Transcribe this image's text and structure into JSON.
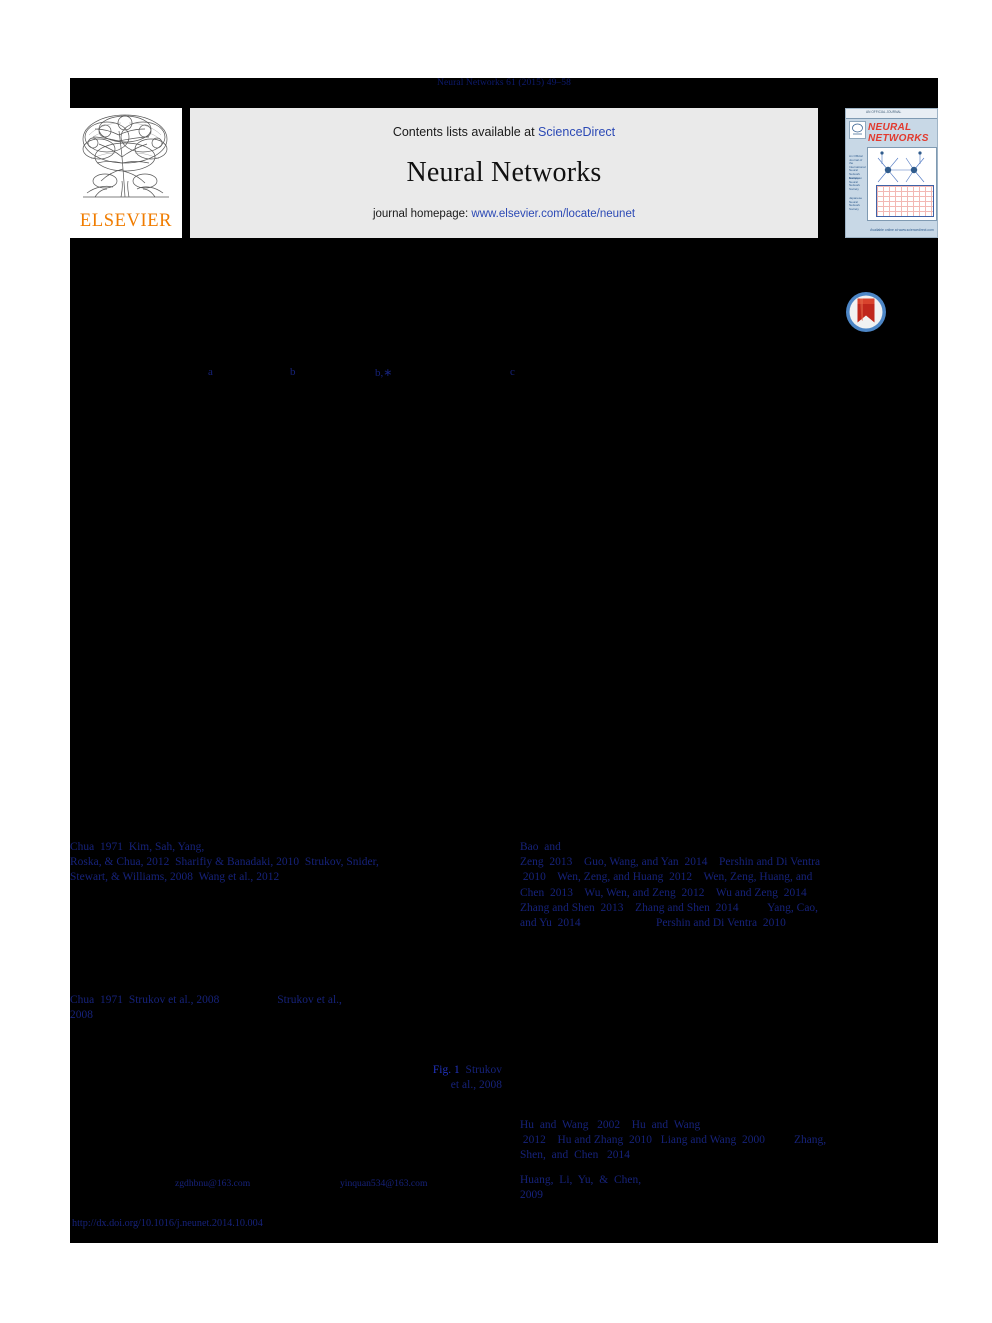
{
  "page": {
    "running_head": "Neural Networks 61 (2015) 49–58"
  },
  "masthead": {
    "publisher_logo_word": "ELSEVIER",
    "contents_prefix": "Contents lists available at ",
    "contents_link": "ScienceDirect",
    "journal_title": "Neural Networks",
    "homepage_prefix": "journal homepage: ",
    "homepage_link": "www.elsevier.com/locate/neunet",
    "cover": {
      "title_line1": "NEURAL",
      "title_line2": "NETWORKS",
      "topbar_text": "AN OFFICIAL JOURNAL",
      "side_text_1": "An Official Journal of the International Neural Network Society",
      "side_text_2": "European Neural Network Society",
      "side_text_3": "Japanese Neural Network Society",
      "bottom_text": "Available online at www.sciencedirect.com"
    },
    "crossmark_label": "CrossMark"
  },
  "affiliations": {
    "markers": [
      "a",
      "b",
      "b,∗",
      "c"
    ]
  },
  "citations": {
    "left_col_1": "Chua  1971  Kim, Sah, Yang,\nRoska, & Chua, 2012  Sharifiy & Banadaki, 2010  Strukov, Snider,\nStewart, & Williams, 2008  Wang et al., 2012",
    "right_col_1": "Bao  and\nZeng  2013    Guo, Wang, and Yan  2014    Pershin and Di Ventra\n 2010    Wen, Zeng, and Huang  2012    Wen, Zeng, Huang, and\nChen  2013    Wu, Wen, and Zeng  2012    Wu and Zeng  2014\nZhang and Shen  2013    Zhang and Shen  2014          Yang, Cao,\nand Yu  2014                          Pershin and Di Ventra  2010",
    "left_col_2": "Chua  1971  Strukov et al., 2008                    Strukov et al.,\n2008",
    "left_col_3_link": "Fig. 1",
    "left_col_3_rest": "  Strukov\net al., 2008",
    "right_col_2": "Hu  and  Wang   2002    Hu  and  Wang\n 2012    Hu and Zhang  2010   Liang and Wang  2000          Zhang,\nShen,  and  Chen   2014",
    "right_col_3": "Huang,  Li,  Yu,  &  Chen,\n2009"
  },
  "footnotes": {
    "email_1": "zgdhbnu@163.com",
    "email_2": "yinquan534@163.com",
    "doi": "http://dx.doi.org/10.1016/j.neunet.2014.10.004"
  },
  "colors": {
    "citation_blue": "#16227a",
    "link_blue": "#2233c0",
    "sciencedirect_blue": "#2b49b5",
    "elsevier_orange": "#f07c00",
    "band_grey": "#eaeaea",
    "redaction_black": "#000000"
  }
}
